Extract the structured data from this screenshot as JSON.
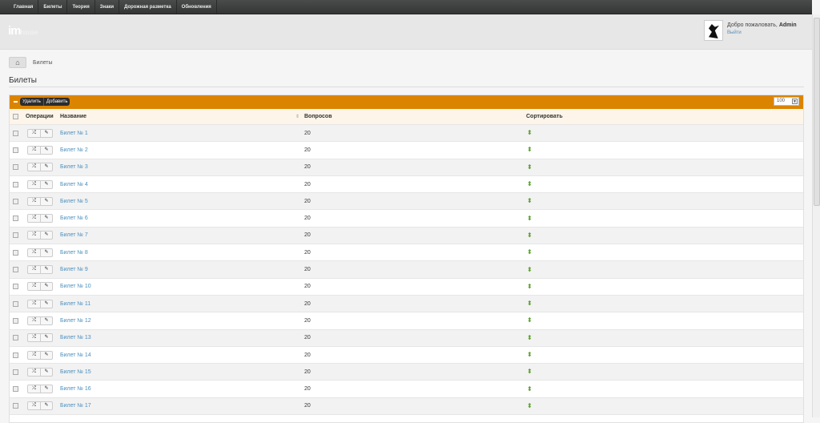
{
  "nav": [
    "Главная",
    "Билеты",
    "Теория",
    "Знаки",
    "Дорожная разметка",
    "Обновления"
  ],
  "logo": {
    "main": "im",
    "sub": "house"
  },
  "user": {
    "welcome": "Добро пожаловать,",
    "name": "Admin",
    "logout": "Выйти"
  },
  "breadcrumb": {
    "current": "Билеты"
  },
  "page_title": "Билеты",
  "toolbar": {
    "delete": "Удалить",
    "add": "Добавить",
    "per_page": "100"
  },
  "columns": {
    "ops": "Операции",
    "name": "Название",
    "questions": "Вопросов",
    "sort": "Сортировать"
  },
  "rows": [
    {
      "name": "Билет № 1",
      "q": "20"
    },
    {
      "name": "Билет № 2",
      "q": "20"
    },
    {
      "name": "Билет № 3",
      "q": "20"
    },
    {
      "name": "Билет № 4",
      "q": "20"
    },
    {
      "name": "Билет № 5",
      "q": "20"
    },
    {
      "name": "Билет № 6",
      "q": "20"
    },
    {
      "name": "Билет № 7",
      "q": "20"
    },
    {
      "name": "Билет № 8",
      "q": "20"
    },
    {
      "name": "Билет № 9",
      "q": "20"
    },
    {
      "name": "Билет № 10",
      "q": "20"
    },
    {
      "name": "Билет № 11",
      "q": "20"
    },
    {
      "name": "Билет № 12",
      "q": "20"
    },
    {
      "name": "Билет № 13",
      "q": "20"
    },
    {
      "name": "Билет № 14",
      "q": "20"
    },
    {
      "name": "Билет № 15",
      "q": "20"
    },
    {
      "name": "Билет № 16",
      "q": "20"
    },
    {
      "name": "Билет № 17",
      "q": "20"
    }
  ],
  "colors": {
    "accent": "#db8400",
    "link": "#4c8fbd",
    "sort": "#5aa02c"
  }
}
